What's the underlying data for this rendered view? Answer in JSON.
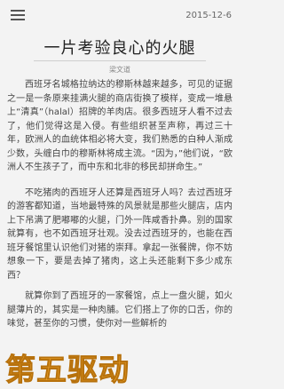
{
  "header": {
    "menu_icon": "hamburger-menu-icon",
    "date": "2015-12-6"
  },
  "article": {
    "title": "一片考验良心的火腿",
    "author": "梁文道",
    "paragraphs": [
      "西班牙名城格拉纳达的穆斯林越来越多，可见的证据之一是一条原来挂满火腿的商店街换了模样，变成一堆悬上“清真”（halal）招牌的羊肉店。很多西班牙人看不过去了，他们觉得这是入侵。有些组织甚至声称，再过三十年，欧洲人的血统体相必将大变，我们熟悉的白种人渐成少数，头缠白巾的穆斯林将成主流。“因为，”他们说，“欧洲人不生孩子了，而中东和北非的移民却拼命生。”",
      "不吃猪肉的西班牙人还算是西班牙人吗？去过西班牙的游客都知道，当地最特殊的风景就是那些火腿店，店内上下吊满了肥嘟嘟的火腿，门外一阵咸香扑鼻。别的国家就算有，也不如西班牙壮观。没去过西班牙的，也能在西班牙餐馆里认识他们对猪的崇拜。拿起一张餐牌，你不妨想象一下，要是去掉了猪肉，这上头还能剩下多少成东西？",
      "就算你到了西班牙的一家餐馆，点上一盘火腿，如火腿薄片的，其实是一种肉脯。它们搭上了你的口舌，你的味觉，甚至你的习惯，使你对一些解析的"
    ]
  },
  "watermark": {
    "text": "第五驱动"
  }
}
